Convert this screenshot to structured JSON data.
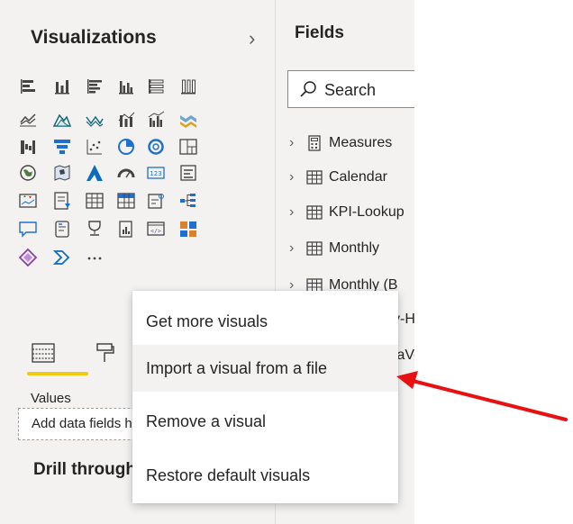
{
  "visualizations": {
    "title": "Visualizations",
    "expand_glyph": "›",
    "icons": [
      "stacked-bar-icon",
      "stacked-column-icon",
      "clustered-bar-icon",
      "clustered-column-icon",
      "100-stacked-bar-icon",
      "100-stacked-column-icon",
      "line-chart-icon",
      "area-chart-icon",
      "stacked-area-icon",
      "line-stacked-column-icon",
      "line-clustered-column-icon",
      "ribbon-chart-icon",
      "waterfall-chart-icon",
      "funnel-icon",
      "scatter-chart-icon",
      "pie-chart-icon",
      "donut-chart-icon",
      "treemap-icon",
      "map-icon",
      "filled-map-icon",
      "azure-map-icon",
      "gauge-icon",
      "card-icon",
      "multi-row-card-icon",
      "kpi-icon",
      "slicer-icon",
      "table-icon",
      "matrix-icon",
      "r-visual-icon",
      "decomposition-tree-icon",
      "qa-icon",
      "smart-narrative-icon",
      "key-influencers-icon",
      "paginated-report-icon",
      "python-visual-icon",
      "custom-visual-icon",
      "power-apps-icon",
      "power-automate-icon",
      "more-options-icon"
    ],
    "more_glyph": "···",
    "accent_color": "#f2c811",
    "values_label": "Values",
    "add_data_placeholder": "Add data fields here",
    "drill_title": "Drill through"
  },
  "fields": {
    "title": "Fields",
    "search_placeholder": "Search",
    "tables": [
      {
        "name": "Measures",
        "icon": "calculator-icon"
      },
      {
        "name": "Calendar",
        "icon": "table-icon"
      },
      {
        "name": "KPI-Lookup",
        "icon": "table-icon"
      },
      {
        "name": "Monthly",
        "icon": "table-icon"
      },
      {
        "name": "Monthly (B",
        "icon": "table-icon"
      },
      {
        "name": "y-H",
        "icon": "table-icon"
      },
      {
        "name": "taVo",
        "icon": "table-icon"
      }
    ]
  },
  "context_menu": {
    "items": [
      "Get more visuals",
      "Import a visual from a file",
      "Remove a visual",
      "Restore default visuals"
    ]
  },
  "annotation": {
    "arrow_color": "#e81010"
  }
}
